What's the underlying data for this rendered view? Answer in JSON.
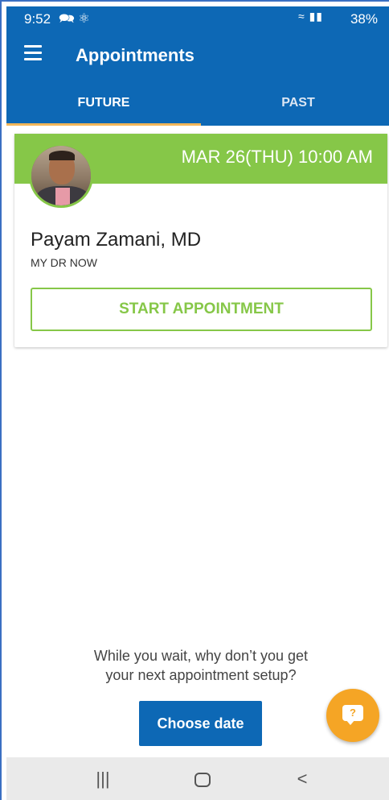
{
  "status_bar": {
    "time": "9:52",
    "battery": "38%"
  },
  "app_bar": {
    "title": "Appointments"
  },
  "tabs": [
    {
      "label": "FUTURE",
      "selected": true
    },
    {
      "label": "PAST",
      "selected": false
    }
  ],
  "appointment": {
    "datetime": "MAR 26(THU) 10:00 AM",
    "doctor_name": "Payam Zamani, MD",
    "organization": "MY DR NOW",
    "start_label": "START APPOINTMENT"
  },
  "prompt": {
    "line1": "While you wait, why don’t you get",
    "line2": "your next appointment setup?"
  },
  "choose_date_label": "Choose date",
  "fab": {
    "icon": "chat-help-icon",
    "glyph": "?"
  },
  "nav_bar": {
    "recents_icon": "recents-icon",
    "home_icon": "home-icon",
    "back_icon": "back-icon"
  },
  "colors": {
    "primary": "#0d68b5",
    "accent_green": "#86c748",
    "tab_indicator": "#f2b65a",
    "fab": "#f5a525"
  }
}
